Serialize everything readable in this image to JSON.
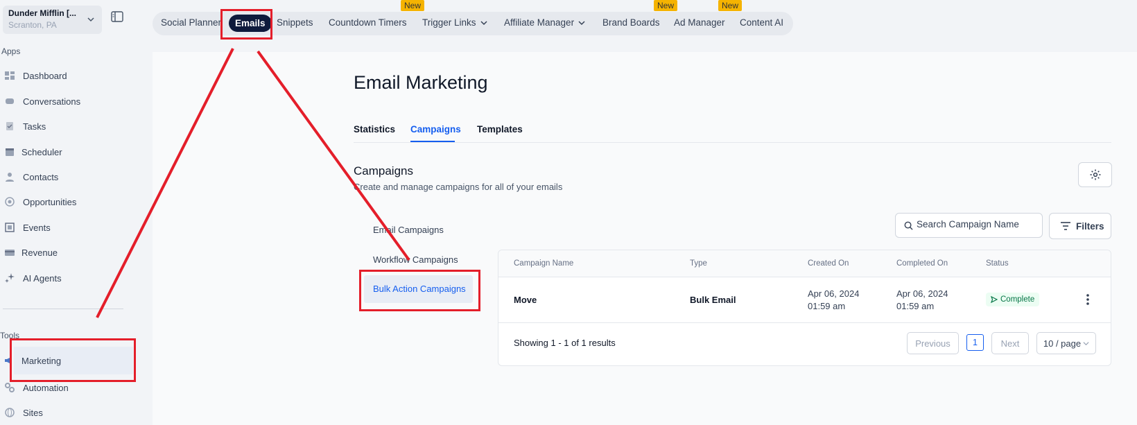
{
  "location": {
    "name": "Dunder Mifflin [...",
    "city": "Scranton, PA"
  },
  "sidebar": {
    "apps_label": "Apps",
    "tools_label": "Tools",
    "apps": [
      {
        "label": "Dashboard",
        "icon": "dashboard-icon"
      },
      {
        "label": "Conversations",
        "icon": "chat-icon"
      },
      {
        "label": "Tasks",
        "icon": "task-icon"
      },
      {
        "label": "Scheduler",
        "icon": "calendar-icon"
      },
      {
        "label": "Contacts",
        "icon": "person-icon"
      },
      {
        "label": "Opportunities",
        "icon": "target-icon"
      },
      {
        "label": "Events",
        "icon": "event-icon"
      },
      {
        "label": "Revenue",
        "icon": "card-icon"
      },
      {
        "label": "AI Agents",
        "icon": "sparkle-icon"
      }
    ],
    "tools": [
      {
        "label": "Marketing",
        "icon": "megaphone-icon"
      },
      {
        "label": "Automation",
        "icon": "gears-icon"
      },
      {
        "label": "Sites",
        "icon": "globe-icon"
      }
    ]
  },
  "topnav": {
    "tabs": [
      {
        "label": "Social Planner"
      },
      {
        "label": "Emails"
      },
      {
        "label": "Snippets"
      },
      {
        "label": "Countdown Timers"
      },
      {
        "label": "Trigger Links"
      },
      {
        "label": "Affiliate Manager"
      },
      {
        "label": "Brand Boards"
      },
      {
        "label": "Ad Manager"
      },
      {
        "label": "Content AI"
      }
    ],
    "badge": "New"
  },
  "page": {
    "title": "Email Marketing",
    "subtabs": [
      "Statistics",
      "Campaigns",
      "Templates"
    ],
    "section_title": "Campaigns",
    "section_desc": "Create and manage campaigns for all of your emails",
    "side_links": [
      "Email Campaigns",
      "Workflow Campaigns",
      "Bulk Action Campaigns"
    ],
    "search_placeholder": "Search Campaign Name",
    "filters_label": "Filters"
  },
  "table": {
    "columns": [
      "Campaign Name",
      "Type",
      "Created On",
      "Completed On",
      "Status"
    ],
    "rows": [
      {
        "name": "Move",
        "type": "Bulk Email",
        "created_date": "Apr 06, 2024",
        "created_time": "01:59 am",
        "completed_date": "Apr 06, 2024",
        "completed_time": "01:59 am",
        "status": "Complete"
      }
    ],
    "showing": "Showing 1 - 1 of 1 results",
    "previous": "Previous",
    "page": "1",
    "next": "Next",
    "per_page": "10 / page"
  },
  "colors": {
    "accent": "#155eef",
    "annotation": "#e41e2a",
    "active_tab": "#0e1a3c",
    "badge": "#f5b301"
  }
}
